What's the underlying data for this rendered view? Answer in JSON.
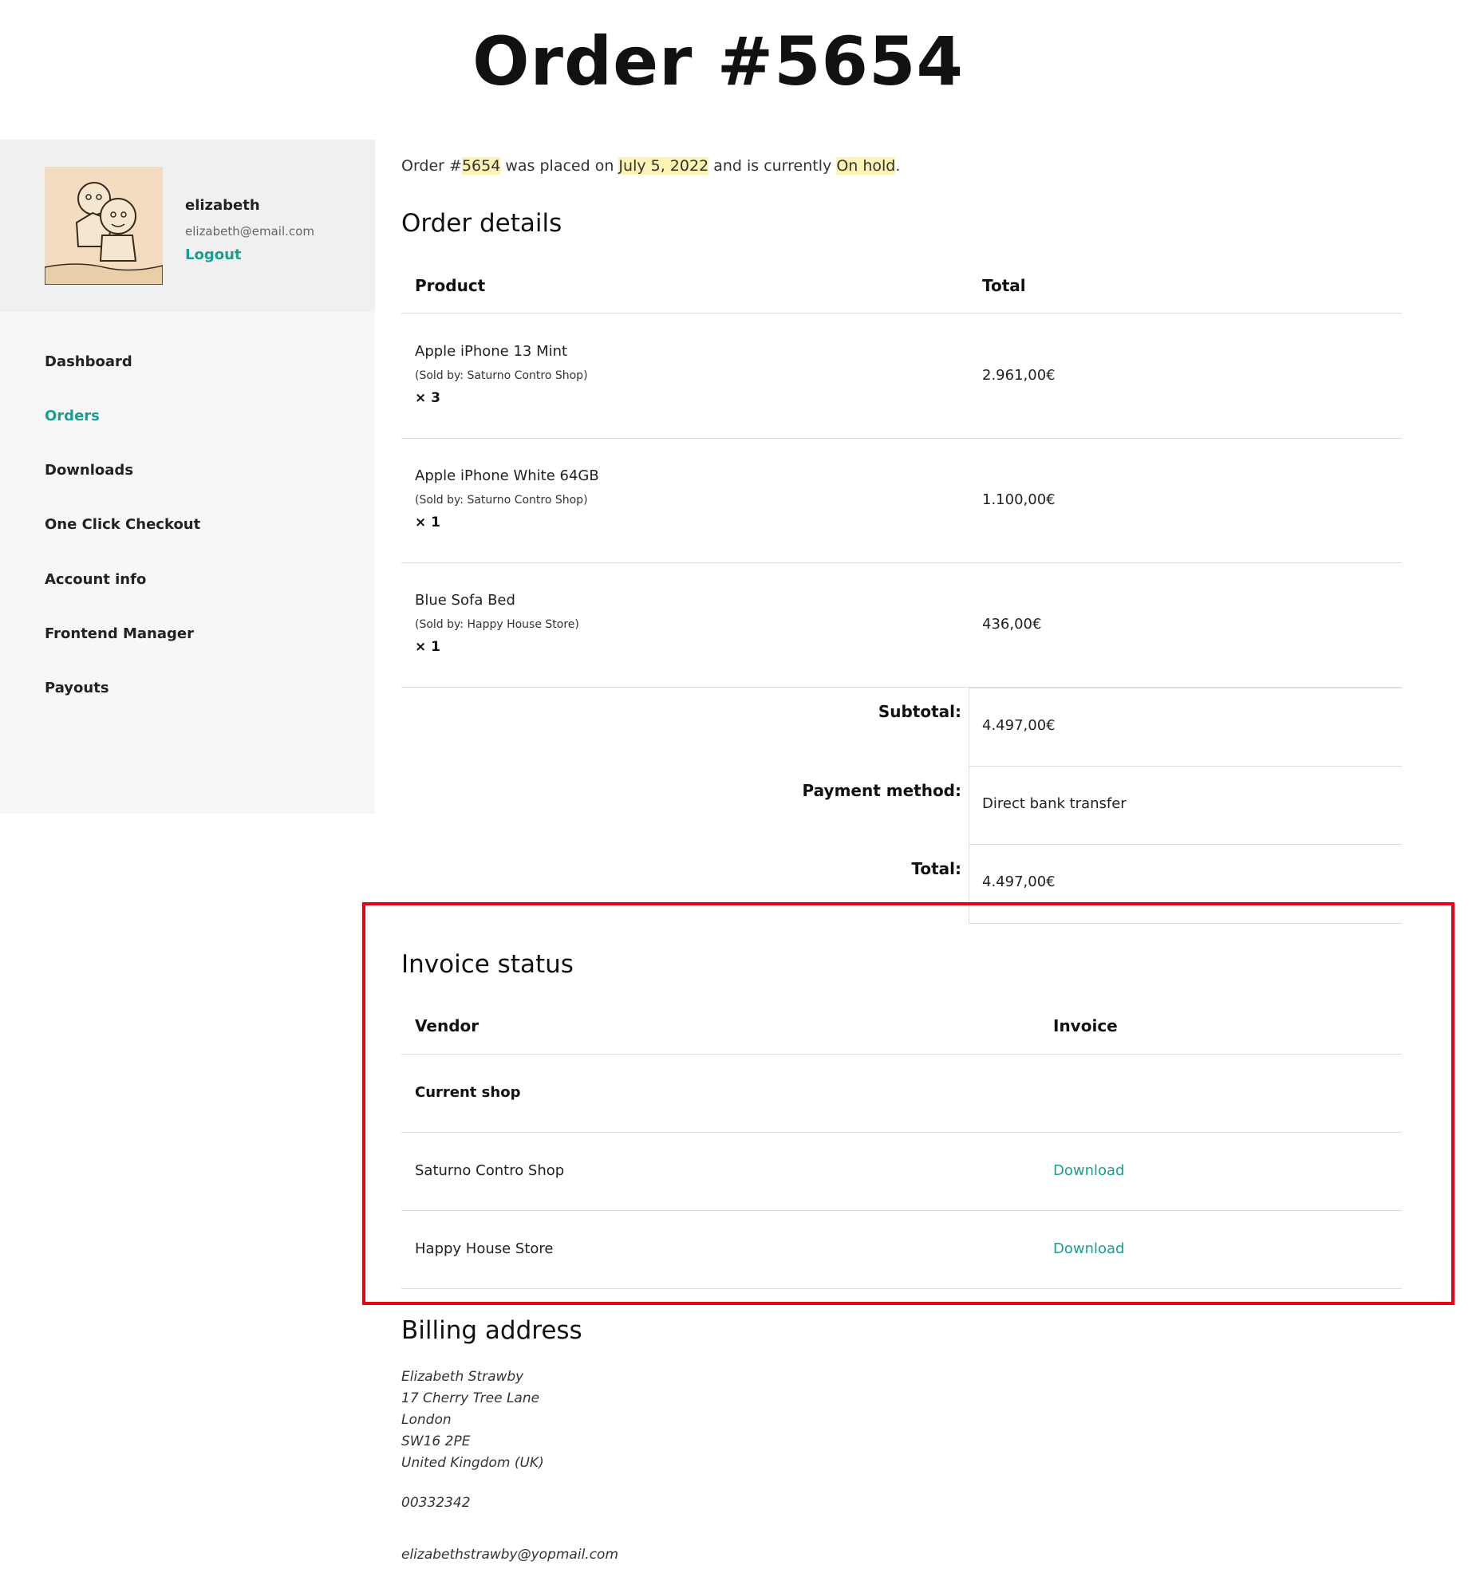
{
  "page": {
    "title": "Order #5654"
  },
  "user": {
    "name": "elizabeth",
    "email": "elizabeth@email.com",
    "logout_label": "Logout"
  },
  "nav": {
    "items": [
      {
        "label": "Dashboard",
        "active": false
      },
      {
        "label": "Orders",
        "active": true
      },
      {
        "label": "Downloads",
        "active": false
      },
      {
        "label": "One Click Checkout",
        "active": false
      },
      {
        "label": "Account info",
        "active": false
      },
      {
        "label": "Frontend Manager",
        "active": false
      },
      {
        "label": "Payouts",
        "active": false
      }
    ]
  },
  "intro": {
    "prefix": "Order #",
    "order_number": "5654",
    "mid1": " was placed on ",
    "date": "July 5, 2022",
    "mid2": " and is currently ",
    "status": "On hold",
    "suffix": "."
  },
  "order_details": {
    "title": "Order details",
    "headers": {
      "product": "Product",
      "total": "Total"
    },
    "items": [
      {
        "name": "Apple iPhone 13 Mint",
        "sold_by": "(Sold by: Saturno Contro Shop)",
        "qty": "× 3",
        "total": "2.961,00€"
      },
      {
        "name": "Apple iPhone White 64GB",
        "sold_by": "(Sold by: Saturno Contro Shop)",
        "qty": "× 1",
        "total": "1.100,00€"
      },
      {
        "name": "Blue Sofa Bed",
        "sold_by": "(Sold by: Happy House Store)",
        "qty": "× 1",
        "total": "436,00€"
      }
    ],
    "totals": [
      {
        "label": "Subtotal:",
        "value": "4.497,00€"
      },
      {
        "label": "Payment method:",
        "value": "Direct bank transfer"
      },
      {
        "label": "Total:",
        "value": "4.497,00€"
      }
    ]
  },
  "invoice_status": {
    "title": "Invoice status",
    "headers": {
      "vendor": "Vendor",
      "invoice": "Invoice"
    },
    "group_label": "Current shop",
    "rows": [
      {
        "vendor": "Saturno Contro Shop",
        "invoice": "Download"
      },
      {
        "vendor": "Happy House Store",
        "invoice": "Download"
      }
    ]
  },
  "billing": {
    "title": "Billing address",
    "lines": [
      "Elizabeth Strawby",
      "17 Cherry Tree Lane",
      "London",
      "SW16 2PE",
      "United Kingdom (UK)"
    ],
    "phone": "00332342",
    "email": "elizabethstrawby@yopmail.com"
  },
  "colors": {
    "accent": "#1a9e8f",
    "highlight": "#fcf3b5",
    "annotation": "#e30613"
  }
}
